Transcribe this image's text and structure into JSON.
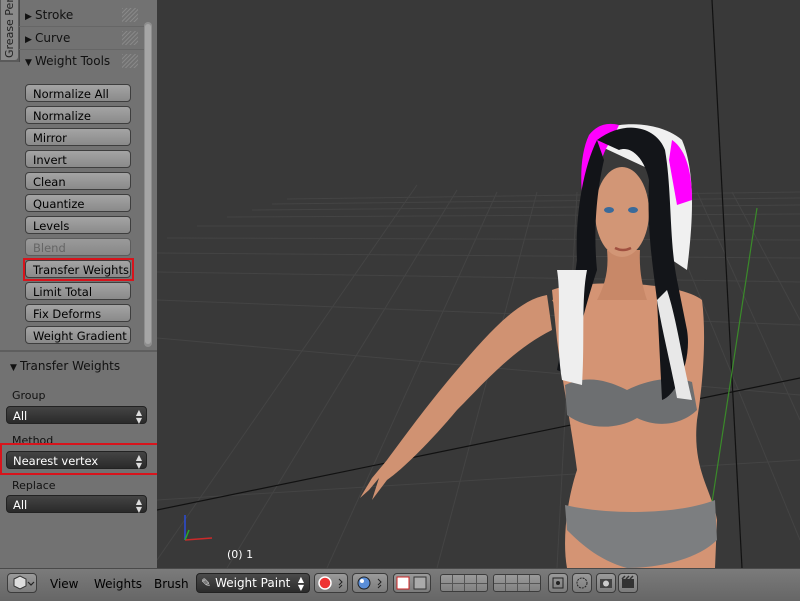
{
  "toolshelf": {
    "tab_label": "Grease Pen",
    "panels": [
      {
        "label": "Stroke",
        "expanded": false
      },
      {
        "label": "Curve",
        "expanded": false
      },
      {
        "label": "Weight Tools",
        "expanded": true
      }
    ],
    "weight_tools": [
      {
        "label": "Normalize All",
        "enabled": true
      },
      {
        "label": "Normalize",
        "enabled": true
      },
      {
        "label": "Mirror",
        "enabled": true
      },
      {
        "label": "Invert",
        "enabled": true
      },
      {
        "label": "Clean",
        "enabled": true
      },
      {
        "label": "Quantize",
        "enabled": true
      },
      {
        "label": "Levels",
        "enabled": true
      },
      {
        "label": "Blend",
        "enabled": false
      },
      {
        "label": "Transfer Weights",
        "enabled": true,
        "highlighted": true
      },
      {
        "label": "Limit Total",
        "enabled": true
      },
      {
        "label": "Fix Deforms",
        "enabled": true
      },
      {
        "label": "Weight Gradient",
        "enabled": true
      }
    ]
  },
  "operator_panel": {
    "title": "Transfer Weights",
    "group": {
      "label": "Group",
      "value": "All"
    },
    "method": {
      "label": "Method",
      "value": "Nearest vertex",
      "highlighted": true
    },
    "replace": {
      "label": "Replace",
      "value": "All"
    }
  },
  "viewport": {
    "frame_info": "(0) 1"
  },
  "header": {
    "menus": [
      "View",
      "Weights",
      "Brush"
    ],
    "mode": "Weight Paint",
    "icons": [
      "editor-type-cube-icon",
      "brush-icon",
      "shading-sphere-icon",
      "face-select-icon",
      "vertex-select-icon",
      "camera-icon",
      "render-icon"
    ]
  },
  "colors": {
    "highlight": "#d8141c",
    "shelf_bg": "#727272",
    "viewport_bg": "#393939",
    "weight_magenta": "#ff00ff"
  }
}
